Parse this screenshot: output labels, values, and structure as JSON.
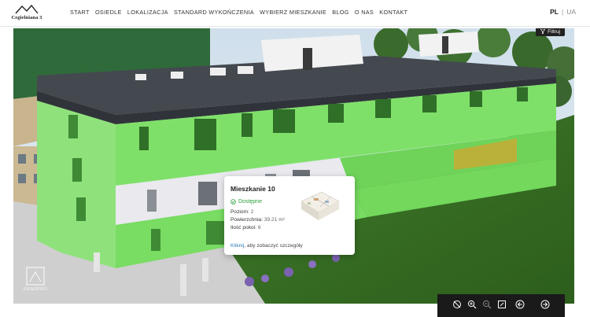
{
  "header": {
    "logo_text": "Cegielniana 3",
    "nav": [
      "START",
      "OSIEDLE",
      "LOKALIZACJA",
      "STANDARD WYKOŃCZENIA",
      "WYBIERZ MIESZKANIE",
      "BLOG",
      "O NAS",
      "KONTAKT"
    ],
    "lang_active": "PL",
    "lang_sep": "|",
    "lang_other": "UA"
  },
  "viewer": {
    "filter_label": "Filtruj",
    "watermark": "RENDPRO"
  },
  "card": {
    "title": "Mieszkanie 10",
    "status": "Dostępne",
    "level_label": "Poziom:",
    "level_value": "2",
    "area_label": "Powierzchnia:",
    "area_value": "39.21 m²",
    "rooms_label": "Ilość pokoi:",
    "rooms_value": "6",
    "link_text": "Kliknij",
    "link_rest": ", aby zobaczyć szczegóły"
  },
  "toolbar": {
    "buttons": [
      "hide-highlight-icon",
      "zoom-in-icon",
      "zoom-out-icon",
      "fullscreen-icon",
      "arrow-left-icon",
      "arrow-right-icon"
    ]
  },
  "colors": {
    "highlight_green": "#7fe069",
    "status_green": "#2e9e3e",
    "link_blue": "#2b7bb9",
    "toolbar_bg": "#1a1a1a"
  }
}
